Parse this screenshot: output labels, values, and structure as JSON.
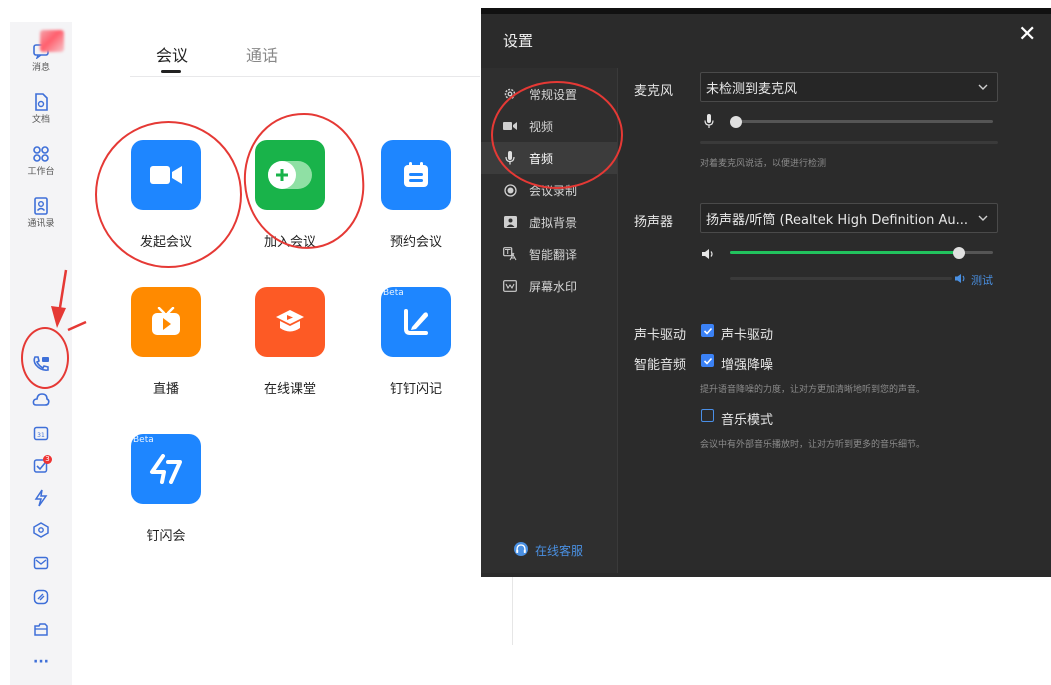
{
  "rail": {
    "items": [
      {
        "label": "消息",
        "icon": "message-icon"
      },
      {
        "label": "文档",
        "icon": "document-icon"
      },
      {
        "label": "工作台",
        "icon": "workbench-icon"
      },
      {
        "label": "通讯录",
        "icon": "contacts-icon"
      }
    ],
    "todo_badge": "3",
    "more": "···"
  },
  "main": {
    "tabs": [
      {
        "label": "会议",
        "active": true
      },
      {
        "label": "通话",
        "active": false
      }
    ],
    "tiles": [
      {
        "label": "发起会议",
        "icon": "video-camera-icon",
        "color": "#1e86ff"
      },
      {
        "label": "加入会议",
        "icon": "join-plus-icon",
        "color": "#19b34a"
      },
      {
        "label": "预约会议",
        "icon": "calendar-icon",
        "color": "#1e86ff"
      },
      {
        "label": "直播",
        "icon": "live-tv-icon",
        "color": "#ff8a00"
      },
      {
        "label": "在线课堂",
        "icon": "classroom-icon",
        "color": "#fd5a25"
      },
      {
        "label": "钉钉闪记",
        "icon": "flash-note-icon",
        "color": "#1e86ff",
        "badge": "Beta"
      },
      {
        "label": "钉闪会",
        "icon": "flash-meeting-icon",
        "color": "#1e86ff",
        "badge": "Beta"
      }
    ]
  },
  "settings": {
    "title": "设置",
    "close": "✕",
    "nav": [
      {
        "label": "常规设置",
        "icon": "gear-icon",
        "active": false
      },
      {
        "label": "视频",
        "icon": "video-icon",
        "active": false
      },
      {
        "label": "音频",
        "icon": "microphone-icon",
        "active": true
      },
      {
        "label": "会议录制",
        "icon": "record-icon",
        "active": false
      },
      {
        "label": "虚拟背景",
        "icon": "virtual-background-icon",
        "active": false
      },
      {
        "label": "智能翻译",
        "icon": "translate-icon",
        "active": false
      },
      {
        "label": "屏幕水印",
        "icon": "watermark-icon",
        "active": false
      }
    ],
    "support": "在线客服",
    "microphone": {
      "label": "麦克风",
      "selected": "未检测到麦克风",
      "level": 0.0,
      "hint": "对着麦克风说话，以便进行检测"
    },
    "speaker": {
      "label": "扬声器",
      "selected": "扬声器/听筒 (Realtek High Definition Au...",
      "volume": 0.87,
      "test": "测试"
    },
    "driver": {
      "label": "声卡驱动",
      "option": "声卡驱动",
      "checked": true
    },
    "smart_audio": {
      "label": "智能音频",
      "noise": {
        "option": "增强降噪",
        "checked": true,
        "hint": "提升语音降噪的力度，让对方更加清晰地听到您的声音。"
      },
      "music": {
        "option": "音乐模式",
        "checked": false,
        "hint": "会议中有外部音乐播放时，让对方听到更多的音乐细节。"
      }
    }
  }
}
